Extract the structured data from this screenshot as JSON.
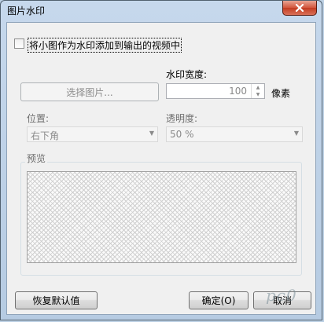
{
  "window": {
    "title": "图片水印"
  },
  "options": {
    "add_watermark_label": "将小图作为水印添加到输出的视频中",
    "add_watermark_checked": false
  },
  "image": {
    "choose_button": "选择图片..."
  },
  "width": {
    "label": "水印宽度:",
    "value": "100",
    "unit": "像素"
  },
  "position": {
    "label": "位置:",
    "value": "右下角"
  },
  "opacity": {
    "label": "透明度:",
    "value": "50 %"
  },
  "preview": {
    "label": "预览"
  },
  "footer": {
    "restore_button": "恢复默认值",
    "ok_button": "确定(O)",
    "cancel_button": "取消"
  },
  "watermark": {
    "logo_text": "pc0"
  }
}
